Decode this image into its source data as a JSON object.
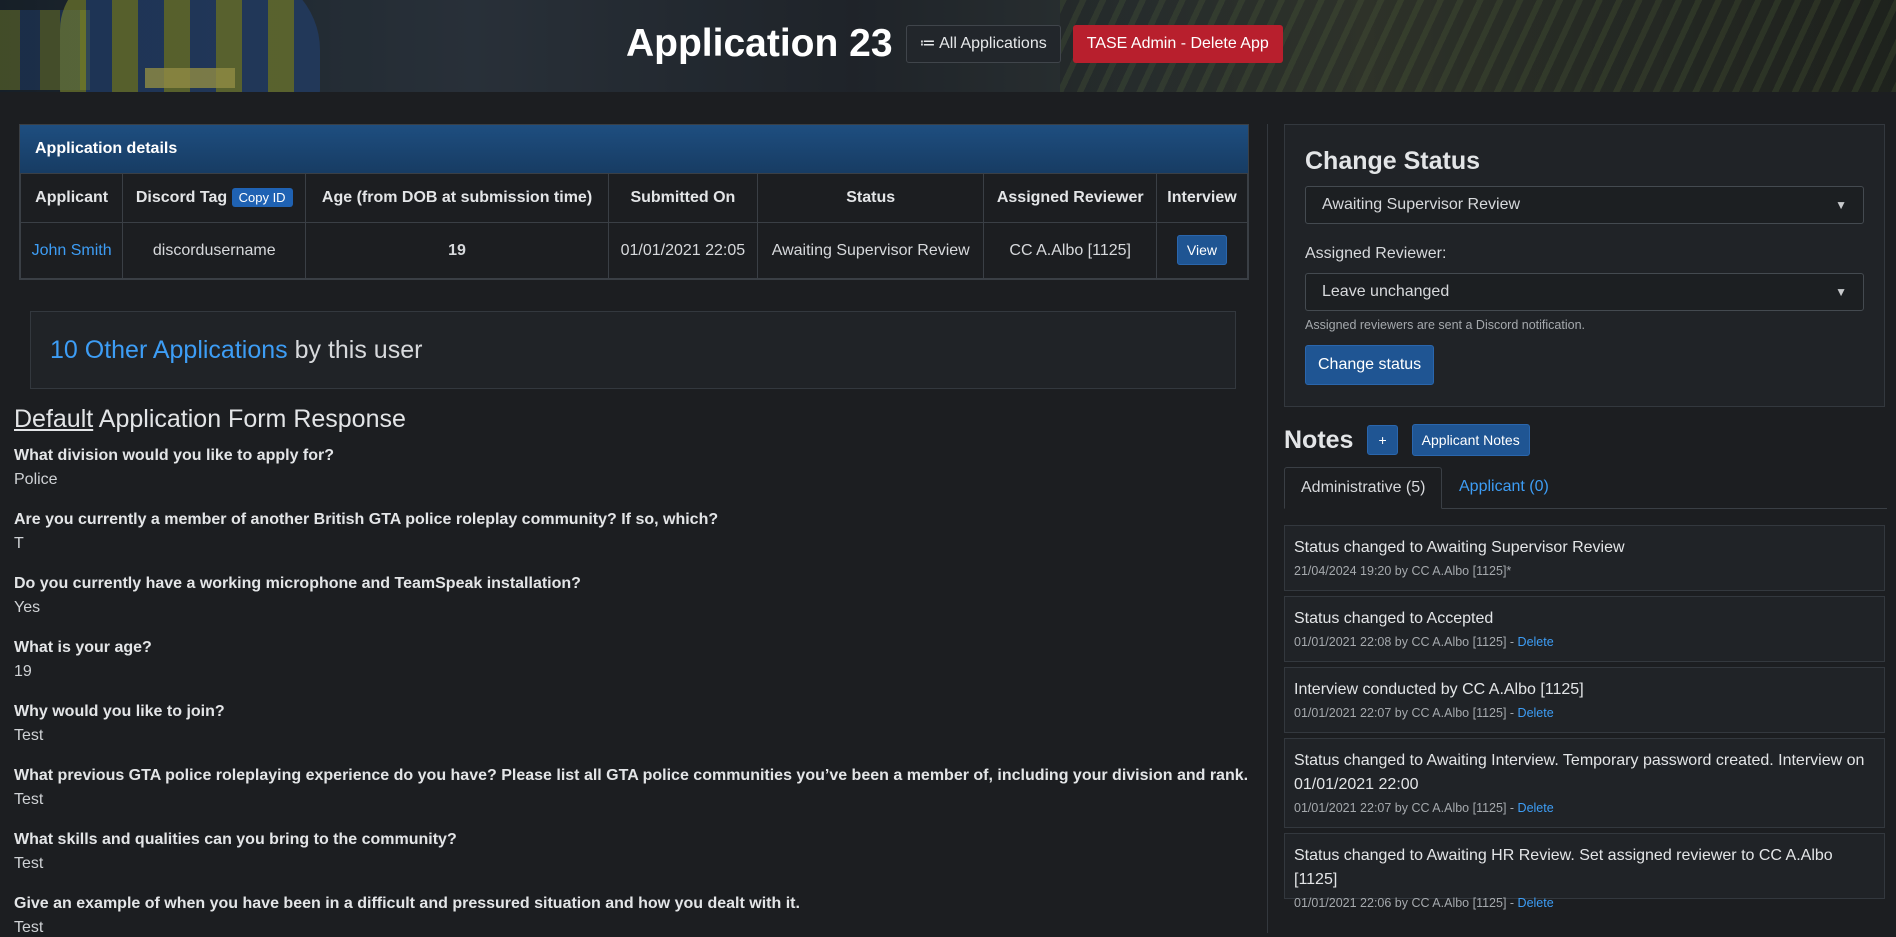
{
  "header": {
    "title": "Application 23",
    "all_apps_icon": "list-icon",
    "all_apps_label": "≔ All Applications",
    "delete_label": "TASE Admin - Delete App"
  },
  "details": {
    "heading": "Application details",
    "columns": [
      "Applicant",
      "Discord Tag",
      "Age (from DOB at submission time)",
      "Submitted On",
      "Status",
      "Assigned Reviewer",
      "Interview"
    ],
    "copy_id_label": "Copy ID",
    "row": {
      "applicant": "John Smith",
      "discord_tag": "discordusername",
      "age": "19",
      "submitted_on": "01/01/2021 22:05",
      "status": "Awaiting Supervisor Review",
      "reviewer": "CC A.Albo [1125]",
      "interview_label": "View"
    }
  },
  "other_apps": {
    "link_text": "10 Other Applications",
    "suffix": "by this user"
  },
  "form": {
    "title_underlined": "Default",
    "title_rest": "Application Form Response",
    "questions": [
      {
        "q": "What division would you like to apply for?",
        "a": "Police"
      },
      {
        "q": "Are you currently a member of another British GTA police roleplay community? If so, which?",
        "a": "T"
      },
      {
        "q": "Do you currently have a working microphone and TeamSpeak installation?",
        "a": "Yes"
      },
      {
        "q": "What is your age?",
        "a": "19"
      },
      {
        "q": "Why would you like to join?",
        "a": "Test"
      },
      {
        "q": "What previous GTA police roleplaying experience do you have? Please list all GTA police communities you’ve been a member of, including your division and rank.",
        "a": "Test"
      },
      {
        "q": "What skills and qualities can you bring to the community?",
        "a": "Test"
      },
      {
        "q": "Give an example of when you have been in a difficult and pressured situation and how you dealt with it.",
        "a": "Test"
      }
    ]
  },
  "change_status": {
    "heading": "Change Status",
    "status_value": "Awaiting Supervisor Review",
    "reviewer_label": "Assigned Reviewer:",
    "reviewer_value": "Leave unchanged",
    "hint": "Assigned reviewers are sent a Discord notification.",
    "button": "Change status"
  },
  "notes": {
    "title": "Notes",
    "add_label": "+",
    "applicant_notes_label": "Applicant Notes",
    "tabs": [
      "Administrative (5)",
      "Applicant (0)"
    ],
    "items": [
      {
        "text": "Status changed to Awaiting Supervisor Review",
        "meta": "21/04/2024 19:20 by CC A.Albo [1125]*",
        "delete": ""
      },
      {
        "text": "Status changed to Accepted",
        "meta": "01/01/2021 22:08 by CC A.Albo [1125] - ",
        "delete": "Delete"
      },
      {
        "text": "Interview conducted by CC A.Albo [1125]",
        "meta": "01/01/2021 22:07 by CC A.Albo [1125] - ",
        "delete": "Delete"
      },
      {
        "text": "Status changed to Awaiting Interview. Temporary password created. Interview on 01/01/2021 22:00",
        "meta": "01/01/2021 22:07 by CC A.Albo [1125] - ",
        "delete": "Delete"
      },
      {
        "text": "Status changed to Awaiting HR Review. Set assigned reviewer to CC A.Albo [1125]",
        "meta": "01/01/2021 22:06 by CC A.Albo [1125] - ",
        "delete": "Delete"
      }
    ]
  }
}
